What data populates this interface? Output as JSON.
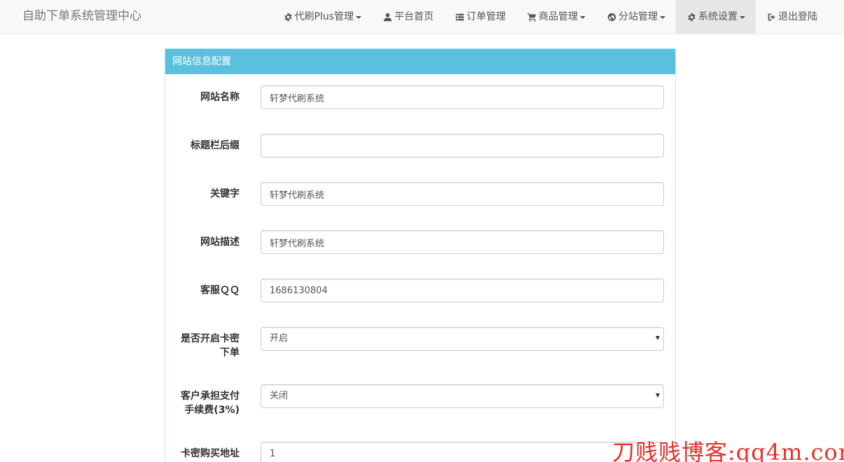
{
  "navbar": {
    "brand": "自助下单系统管理中心",
    "items": [
      {
        "label": "代刷Plus管理",
        "icon": "gear-icon",
        "dropdown": true,
        "active": false
      },
      {
        "label": "平台首页",
        "icon": "user-icon",
        "dropdown": false,
        "active": false
      },
      {
        "label": "订单管理",
        "icon": "list-icon",
        "dropdown": false,
        "active": false
      },
      {
        "label": "商品管理",
        "icon": "cart-icon",
        "dropdown": true,
        "active": false
      },
      {
        "label": "分站管理",
        "icon": "globe-icon",
        "dropdown": true,
        "active": false
      },
      {
        "label": "系统设置",
        "icon": "gear-icon",
        "dropdown": true,
        "active": true
      },
      {
        "label": "退出登陆",
        "icon": "logout-icon",
        "dropdown": false,
        "active": false
      }
    ]
  },
  "panel": {
    "title": "网站信息配置",
    "fields": {
      "site_name": {
        "label": "网站名称",
        "value": "轩梦代刷系统"
      },
      "title_suffix": {
        "label": "标题栏后缀",
        "value": ""
      },
      "keywords": {
        "label": "关键字",
        "value": "轩梦代刷系统"
      },
      "description": {
        "label": "网站描述",
        "value": "轩梦代刷系统"
      },
      "service_qq": {
        "label": "客服ＱＱ",
        "value": "1686130804"
      },
      "card_order": {
        "label_line1": "是否开启卡密",
        "label_line2": "下单",
        "value": "开启"
      },
      "fee": {
        "label_line1": "客户承担支付",
        "label_line2": "手续费(3%)",
        "value": "关闭"
      },
      "card_url": {
        "label": "卡密购买地址",
        "value": "1"
      }
    }
  },
  "watermark": "刀贱贱博客:qq4m.com",
  "colors": {
    "panel_heading": "#5bc0de",
    "navbar_bg": "#f8f8f8",
    "watermark": "#e8302a"
  }
}
